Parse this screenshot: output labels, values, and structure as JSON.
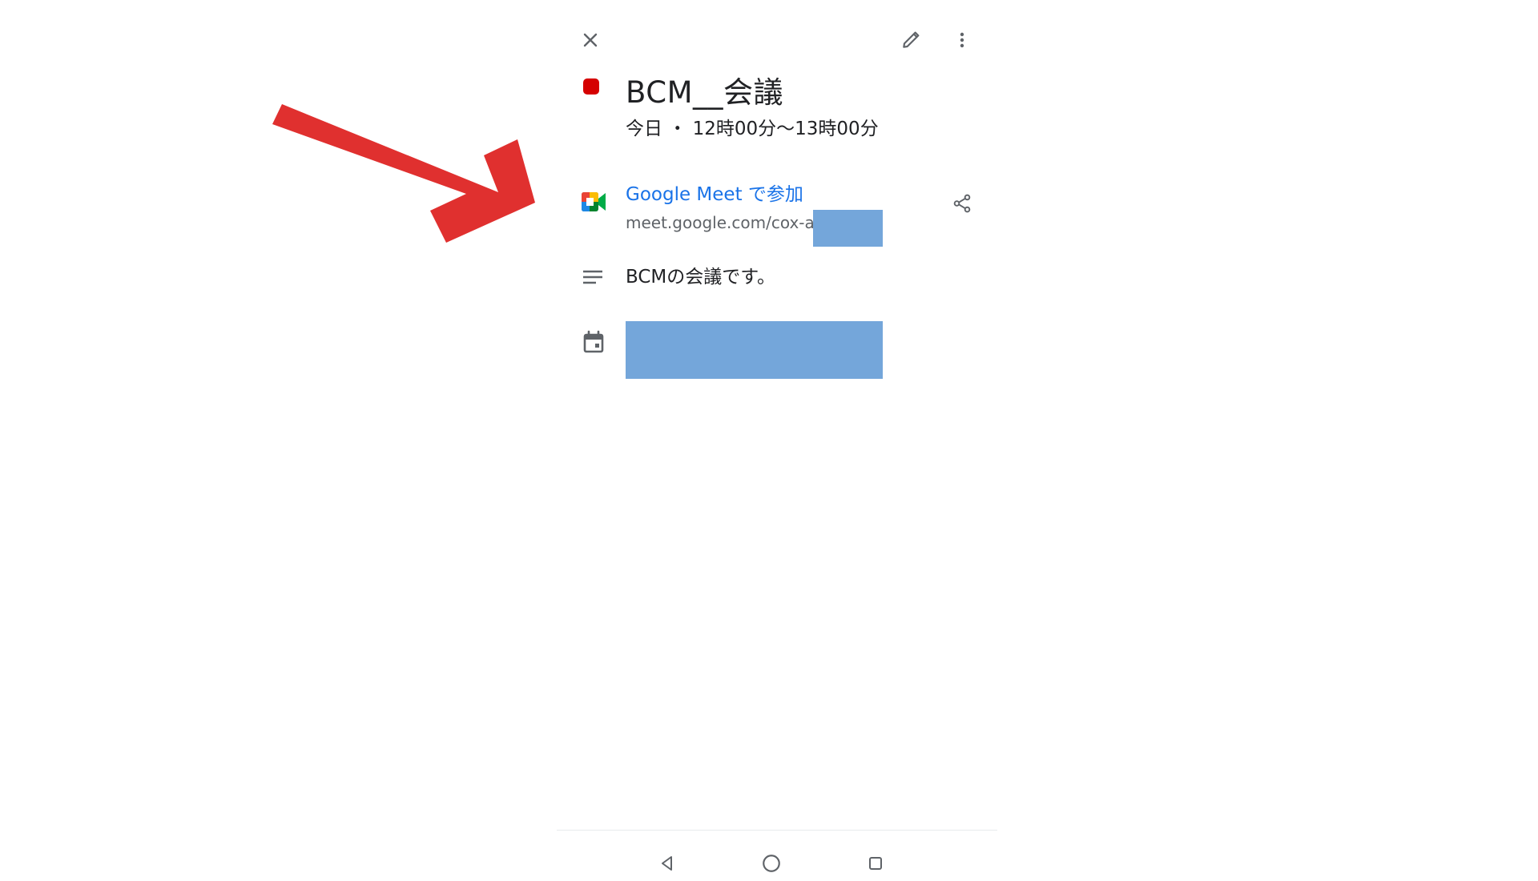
{
  "event": {
    "title": "BCM__会議",
    "datetime": "今日 ・ 12時00分〜13時00分",
    "color": "#d50000"
  },
  "meet": {
    "join_label": "Google Meet で参加",
    "url": "meet.google.com/cox-a",
    "link_color": "#1a73e8"
  },
  "description": {
    "text": "BCMの会議です。"
  },
  "icons": {
    "close": "close-icon",
    "edit": "pencil-icon",
    "more": "more-vert-icon",
    "share": "share-icon",
    "description": "notes-icon",
    "calendar": "calendar-icon",
    "nav_back": "triangle-back-icon",
    "nav_home": "circle-home-icon",
    "nav_recents": "square-recents-icon"
  },
  "annotation": {
    "arrow_color": "#e0302f"
  },
  "redaction_color": "#74a6da"
}
